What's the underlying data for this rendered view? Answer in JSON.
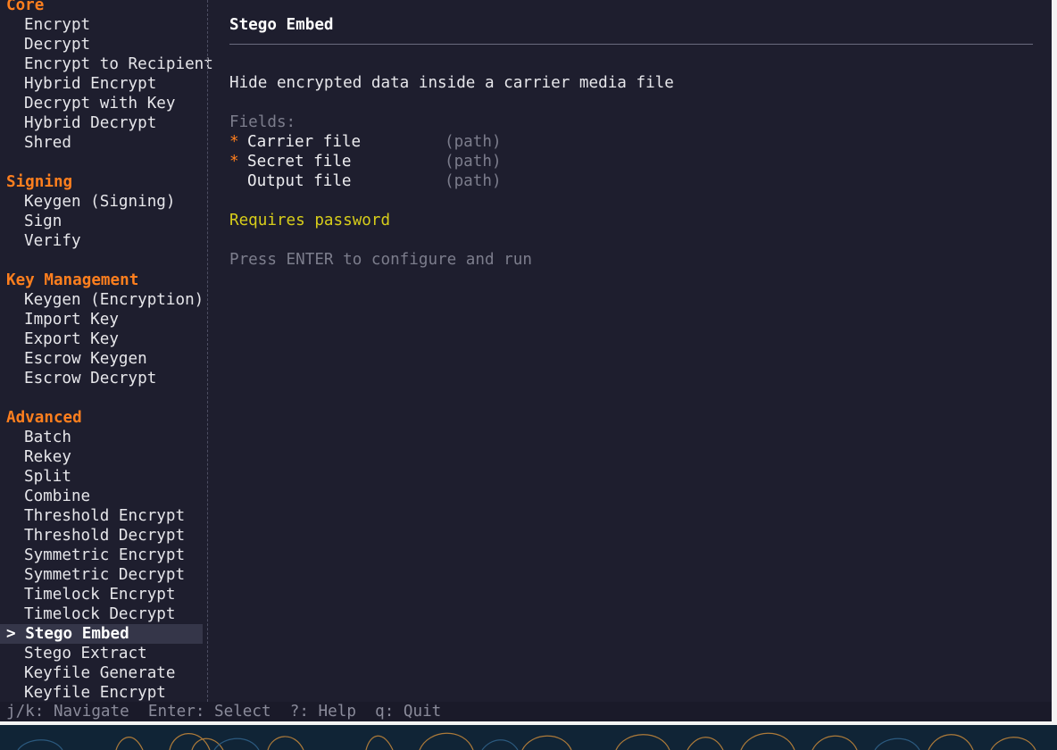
{
  "sidebar": {
    "sections": [
      {
        "heading": "Core",
        "items": [
          "Encrypt",
          "Decrypt",
          "Encrypt to Recipient",
          "Hybrid Encrypt",
          "Decrypt with Key",
          "Hybrid Decrypt",
          "Shred"
        ]
      },
      {
        "heading": "Signing",
        "items": [
          "Keygen (Signing)",
          "Sign",
          "Verify"
        ]
      },
      {
        "heading": "Key Management",
        "items": [
          "Keygen (Encryption)",
          "Import Key",
          "Export Key",
          "Escrow Keygen",
          "Escrow Decrypt"
        ]
      },
      {
        "heading": "Advanced",
        "items": [
          "Batch",
          "Rekey",
          "Split",
          "Combine",
          "Threshold Encrypt",
          "Threshold Decrypt",
          "Symmetric Encrypt",
          "Symmetric Decrypt",
          "Timelock Encrypt",
          "Timelock Decrypt",
          "Stego Embed",
          "Stego Extract",
          "Keyfile Generate",
          "Keyfile Encrypt"
        ]
      }
    ],
    "selected_marker": "> ",
    "selected": "Stego Embed"
  },
  "main": {
    "title": "Stego Embed",
    "description": "Hide encrypted data inside a carrier media file",
    "fields_label": "Fields:",
    "required_marker": "*",
    "fields": [
      {
        "name": "Carrier file",
        "type": "(path)",
        "required": true
      },
      {
        "name": "Secret file",
        "type": "(path)",
        "required": true
      },
      {
        "name": "Output file",
        "type": "(path)",
        "required": false
      }
    ],
    "password_note": "Requires password",
    "hint": "Press ENTER to configure and run"
  },
  "statusbar": {
    "text": "j/k: Navigate  Enter: Select  ?: Help  q: Quit"
  },
  "colors": {
    "background": "#1e1e2e",
    "section_heading": "#ff7f1e",
    "required_marker": "#ff7f1e",
    "password_note": "#d7cd1a",
    "dim_text": "#7c7d8c",
    "selected_bg": "#353649"
  }
}
